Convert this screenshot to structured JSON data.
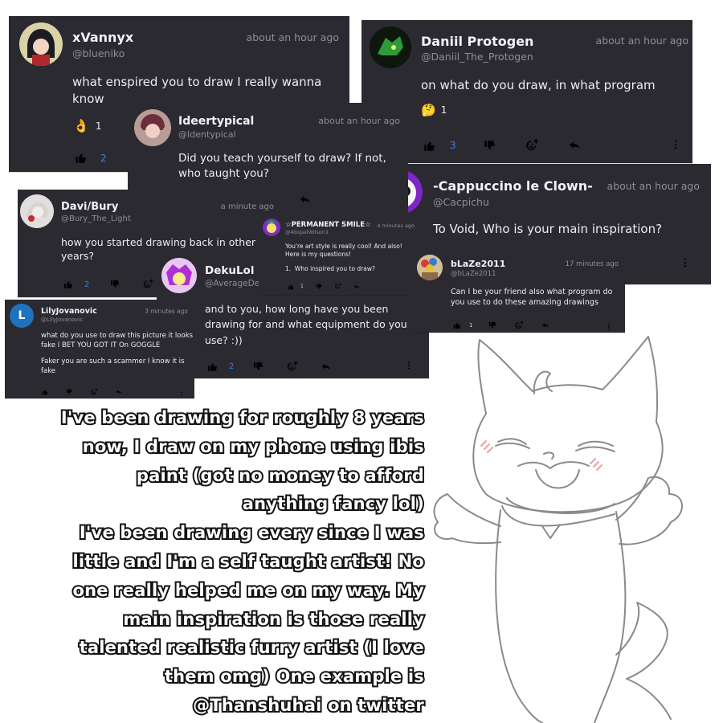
{
  "comments": {
    "xvannyx": {
      "name": "xVannyx",
      "handle": "@blueniko",
      "time": "about an hour ago",
      "text": "what enspired you to draw I really wanna know",
      "reaction_emoji": "👌",
      "reaction_count": "1",
      "like_count": "2"
    },
    "daniil": {
      "name": "Daniil Protogen",
      "handle": "@Daniil_The_Protogen",
      "time": "about an hour ago",
      "text": "on what do you draw, in what program",
      "reaction_emoji": "🤔",
      "reaction_count": "1",
      "like_count": "3"
    },
    "ideertypical": {
      "name": "Ideertypical",
      "handle": "@Identypical",
      "time": "about an hour ago",
      "text": "Did you teach yourself to draw? If not, who taught you?"
    },
    "cappuccino": {
      "name": "-Cappuccino le Clown-",
      "handle": "@Cacpichu",
      "time": "about an hour ago",
      "text": "To Void, Who is your main inspiration?"
    },
    "davi": {
      "name": "Davi/Bury",
      "handle": "@Bury_The_Light",
      "time": "a minute ago",
      "text": "how you started drawing back in other years?",
      "like_count": "2"
    },
    "permanent": {
      "name": "☆PERMANENT SMILE☆",
      "handle": "@AbigailWilson1",
      "time": "4 minutes ago",
      "text": "You're art style is really cool! And also! Here is my questions!",
      "list_item": "1.  Who inspired you to draw?",
      "like_count": "1"
    },
    "blaze": {
      "name": "bLaZe2011",
      "handle": "@bLaZe2011",
      "time": "17 minutes ago",
      "text": "Can I be your friend also what program do you use to do these amazing drawings",
      "like_count": "1"
    },
    "dekulol": {
      "name": "DekuLol",
      "handle": "@AverageDel",
      "text": "and to you, how long have you been drawing for and what equipment do you use? :))",
      "like_count": "2"
    },
    "lily": {
      "name": "LilyJovanovic",
      "handle": "@LilyJovanovic",
      "time": "3 minutes ago",
      "avatar_letter": "L",
      "text": "what do you use to draw this picture it looks fake I BET YOU GOT IT On GOGGLE",
      "text2": "Faker you are such a scammer I know it is fake"
    }
  },
  "answer": {
    "lines": [
      "I've been drawing for roughly 8 years",
      "now, I draw on my phone using ibis",
      "paint (got no money to afford",
      "anything fancy lol)",
      "I've been drawing every since I was",
      "little and I'm a self taught artist! No",
      "one really helped me on my way. My",
      "main inspiration is those really",
      "talented realistic furry artist (I love",
      "them omg) One example is",
      "@Thanshuhai on twitter"
    ]
  },
  "colors": {
    "card_bg": "#2b2a31",
    "like_blue": "#3b7ee6",
    "muted_text": "#8e8d96"
  },
  "icons": [
    "thumbs-up-icon",
    "thumbs-down-icon",
    "add-reaction-icon",
    "reply-icon",
    "more-vertical-icon"
  ]
}
